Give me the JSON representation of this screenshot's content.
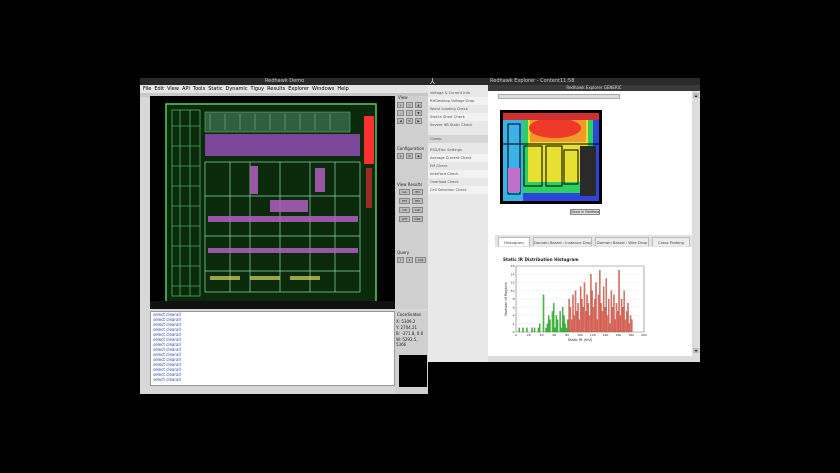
{
  "taskbar": {
    "items": [
      {
        "label": "Redhawk Demo"
      },
      {
        "label": "Redhawk Explorer - Content"
      },
      {
        "label": "11:58"
      }
    ]
  },
  "left_app": {
    "menu": [
      "File",
      "Edit",
      "View",
      "API",
      "Tools",
      "Static",
      "Dynamic",
      "Tiguy",
      "Results",
      "Explorer",
      "Windows",
      "Help"
    ],
    "panels": {
      "view": "View",
      "configuration": "Configuration",
      "view_results": "View Results",
      "query": "Query"
    },
    "result_buttons": [
      "GA",
      "PD",
      "EM",
      "EM",
      "CP",
      "CLK",
      "LPH",
      "GSR"
    ],
    "query_button": "CLR",
    "console_lines": [
      "select clearall",
      "select clearall",
      "select clearall",
      "select clearall",
      "select clearall",
      "select clearall",
      "select clearall",
      "select clearall",
      "select clearall",
      "select clearall",
      "select clearall",
      "select clearall",
      "select clearall",
      "select clearall"
    ],
    "coordinates": {
      "title": "Coordinates",
      "x": "X: 5309.2",
      "y": "Y: 2704.21",
      "b": "B: -371.8, 0.0",
      "w": "W: 5292.5, 5366"
    }
  },
  "mid_list": {
    "items": [
      "Voltage & Current Info",
      "RHDesktop Voltage Drop",
      "Worst Loading Check",
      "Switch Short Check",
      "Severe HB Static Check",
      "Clamp",
      "ESD/Elec Settings",
      "Average Current Check",
      "EM Check",
      "Interface Check",
      "Overload Check",
      "Cell Selection Check"
    ]
  },
  "browser": {
    "title": "Redhawk Explorer GENERIC",
    "show_button": "Show in RedHawk",
    "tabs": [
      "Histogram",
      "Domain Based : Instance Drop",
      "Domain Based : Wire Drop",
      "Cross Probing"
    ],
    "chart_data": {
      "type": "bar",
      "title": "Static IR Distribution Histogram",
      "xlabel": "Static IR (mV)",
      "ylabel": "Number of Regions",
      "xlim": [
        0,
        200
      ],
      "ylim": [
        0,
        16
      ],
      "xticks": [
        "0",
        "20",
        "40",
        "60",
        "80",
        "100",
        "120",
        "140",
        "160",
        "180",
        "200"
      ],
      "yticks": [
        "0",
        "2",
        "4",
        "6",
        "8",
        "10",
        "12",
        "14",
        "16"
      ],
      "bin_width": 2,
      "series": [
        {
          "color": "#33c433",
          "x": [
            2,
            4,
            6,
            8,
            10,
            12,
            14,
            16,
            18,
            20,
            22,
            24,
            26,
            28,
            30,
            32,
            34,
            36,
            38,
            40,
            42,
            44,
            46,
            48,
            50,
            52,
            54,
            56,
            58,
            60,
            62,
            64,
            66,
            68,
            70,
            72,
            74,
            76,
            78,
            80,
            82
          ],
          "values": [
            0,
            0,
            1,
            0,
            0,
            1,
            0,
            0,
            1,
            0,
            0,
            0,
            1,
            0,
            1,
            0,
            0,
            1,
            2,
            0,
            0,
            9,
            0,
            1,
            2,
            4,
            3,
            0,
            5,
            7,
            1,
            4,
            3,
            0,
            5,
            1,
            6,
            4,
            2,
            1,
            3
          ]
        },
        {
          "color": "#f26a5a",
          "x": [
            84,
            86,
            88,
            90,
            92,
            94,
            96,
            98,
            100,
            102,
            104,
            106,
            108,
            110,
            112,
            114,
            116,
            118,
            120,
            122,
            124,
            126,
            128,
            130,
            132,
            134,
            136,
            138,
            140,
            142,
            144,
            146,
            148,
            150,
            152,
            154,
            156,
            158,
            160,
            162,
            164,
            166,
            168,
            170,
            172,
            174,
            176,
            178,
            180,
            182
          ],
          "values": [
            8,
            6,
            3,
            9,
            4,
            10,
            5,
            7,
            3,
            11,
            8,
            6,
            12,
            5,
            9,
            7,
            4,
            14,
            10,
            6,
            8,
            12,
            3,
            9,
            15,
            7,
            5,
            11,
            6,
            13,
            4,
            8,
            2,
            10,
            6,
            9,
            3,
            7,
            5,
            15,
            4,
            8,
            6,
            10,
            3,
            5,
            7,
            2,
            4,
            3
          ]
        }
      ]
    }
  }
}
